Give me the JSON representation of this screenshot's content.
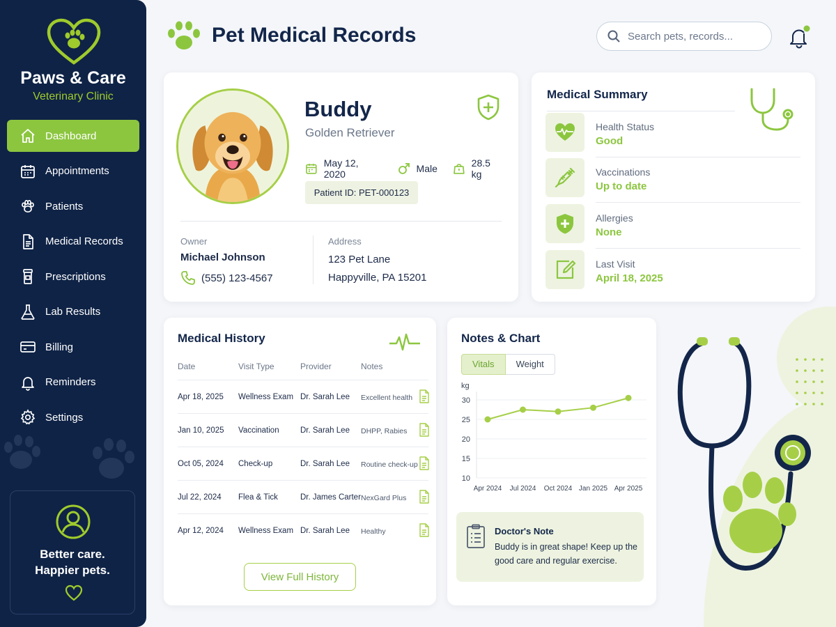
{
  "brand": {
    "name": "Paws & Care",
    "subtitle": "Veterinary Clinic"
  },
  "nav": [
    {
      "label": "Dashboard",
      "icon": "home-icon",
      "active": true
    },
    {
      "label": "Appointments",
      "icon": "calendar-icon"
    },
    {
      "label": "Patients",
      "icon": "paw-icon"
    },
    {
      "label": "Medical Records",
      "icon": "document-icon"
    },
    {
      "label": "Prescriptions",
      "icon": "pill-bottle-icon"
    },
    {
      "label": "Lab Results",
      "icon": "flask-icon"
    },
    {
      "label": "Billing",
      "icon": "credit-card-icon"
    },
    {
      "label": "Reminders",
      "icon": "bell-icon"
    },
    {
      "label": "Settings",
      "icon": "gear-icon"
    }
  ],
  "sidebar_card": {
    "line1": "Better care.",
    "line2": "Happier pets."
  },
  "header": {
    "title": "Pet Medical Records",
    "search_placeholder": "Search pets, records..."
  },
  "pet": {
    "name": "Buddy",
    "breed": "Golden Retriever",
    "birth_date": "May 12, 2020",
    "sex": "Male",
    "weight": "28.5 kg",
    "patient_id": "Patient ID: PET-000123",
    "owner_label": "Owner",
    "owner_name": "Michael Johnson",
    "phone": "(555) 123-4567",
    "address_label": "Address",
    "address_line1": "123 Pet Lane",
    "address_line2": "Happyville, PA 15201"
  },
  "summary": {
    "title": "Medical Summary",
    "items": [
      {
        "label": "Health Status",
        "value": "Good",
        "icon": "heart-pulse-icon"
      },
      {
        "label": "Vaccinations",
        "value": "Up to date",
        "icon": "syringe-icon"
      },
      {
        "label": "Allergies",
        "value": "None",
        "icon": "shield-plus-icon"
      },
      {
        "label": "Last Visit",
        "value": "April 18, 2025",
        "icon": "edit-note-icon"
      }
    ]
  },
  "history": {
    "title": "Medical History",
    "columns": [
      "Date",
      "Visit Type",
      "Provider",
      "Notes"
    ],
    "rows": [
      [
        "Apr 18, 2025",
        "Wellness Exam",
        "Dr. Sarah Lee",
        "Excellent health"
      ],
      [
        "Jan 10, 2025",
        "Vaccination",
        "Dr. Sarah Lee",
        "DHPP, Rabies"
      ],
      [
        "Oct 05, 2024",
        "Check-up",
        "Dr. Sarah Lee",
        "Routine check-up"
      ],
      [
        "Jul 22, 2024",
        "Flea & Tick",
        "Dr. James Carter",
        "NexGard Plus"
      ],
      [
        "Apr 12, 2024",
        "Wellness Exam",
        "Dr. Sarah Lee",
        "Healthy"
      ]
    ],
    "button": "View Full History"
  },
  "notes_chart": {
    "title": "Notes & Chart",
    "tabs": [
      "Vitals",
      "Weight"
    ],
    "note_title": "Doctor's Note",
    "note_text": "Buddy is in great shape! Keep up the good care and regular exercise."
  },
  "chart_data": {
    "type": "line",
    "ylabel": "kg",
    "categories": [
      "Apr 2024",
      "Jul 2024",
      "Oct 2024",
      "Jan 2025",
      "Apr 2025"
    ],
    "values": [
      25,
      27.5,
      27,
      28,
      30.5
    ],
    "ylim": [
      10,
      30
    ],
    "yticks": [
      30,
      25,
      20,
      15,
      10
    ],
    "grid": true,
    "color": "#a6cf47"
  },
  "colors": {
    "sidebar": "#0f2346",
    "accent": "#8cc63f",
    "navy": "#13264a"
  }
}
